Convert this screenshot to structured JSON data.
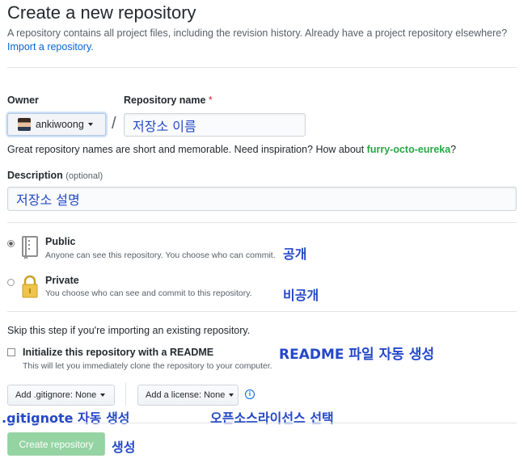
{
  "header": {
    "title": "Create a new repository",
    "subtitle": "A repository contains all project files, including the revision history. Already have a project repository elsewhere?",
    "import_link": "Import a repository."
  },
  "owner": {
    "label": "Owner",
    "value": "ankiwoong"
  },
  "repo_name": {
    "label": "Repository name",
    "required_mark": "*",
    "value": "저장소 이름",
    "separator": "/"
  },
  "hint": {
    "text": "Great repository names are short and memorable. Need inspiration? How about ",
    "suggestion": "furry-octo-eureka",
    "suffix": "?"
  },
  "description": {
    "label": "Description",
    "optional": "(optional)",
    "value": "저장소 설명"
  },
  "visibility": {
    "public": {
      "title": "Public",
      "desc": "Anyone can see this repository. You choose who can commit.",
      "annotation": "공개",
      "checked": true,
      "icon": "repo-book-icon"
    },
    "private": {
      "title": "Private",
      "desc": "You choose who can see and commit to this repository.",
      "annotation": "비공개",
      "checked": false,
      "icon": "lock-icon"
    }
  },
  "init": {
    "skip_text": "Skip this step if you're importing an existing repository.",
    "readme_label": "Initialize this repository with a README",
    "readme_desc": "This will let you immediately clone the repository to your computer.",
    "readme_annotation": "README 파일 자동 생성"
  },
  "options": {
    "gitignore_label": "Add .gitignore:",
    "gitignore_value": "None",
    "license_label": "Add a license:",
    "license_value": "None",
    "gitignore_annotation": ".gitignote 자동 생성",
    "license_annotation": "오픈소스라이선스 선택"
  },
  "submit": {
    "label": "Create repository",
    "annotation": "생성"
  },
  "colors": {
    "annotation": "#2448c8",
    "link": "#0366d6",
    "suggestion": "#28a745",
    "create_button": "#94d3a2"
  }
}
